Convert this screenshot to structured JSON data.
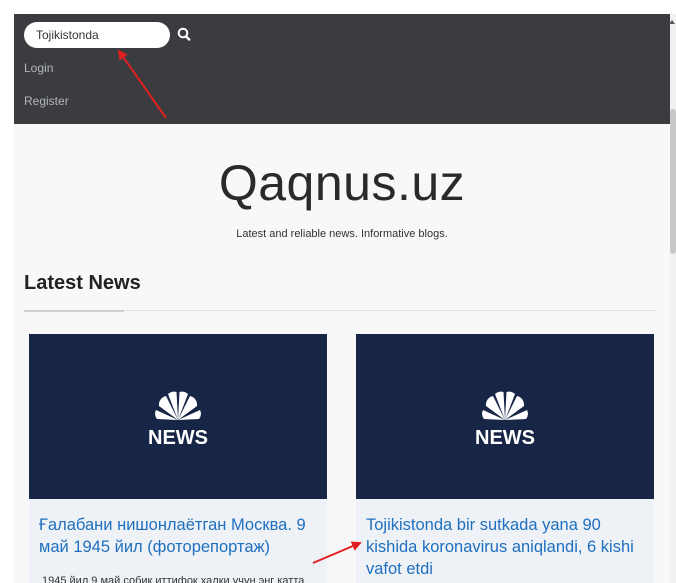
{
  "navbar": {
    "search": {
      "value": "Tojikistonda",
      "icon": "search-icon"
    },
    "login_label": "Login",
    "register_label": "Register"
  },
  "hero": {
    "site_title": "Qaqnus.uz",
    "tagline": "Latest and reliable news. Informative blogs."
  },
  "latest_news": {
    "heading": "Latest News",
    "cards": [
      {
        "image_logo_label": "NEWS",
        "title": "Ғалабани нишонлаётган Москва. 9 май 1945 йил (фоторепортаж)",
        "excerpt": "1945 йил 9 май собиқ иттифоқ халқи учун энг катта"
      },
      {
        "image_logo_label": "NEWS",
        "title": "Tojikistonda bir sutkada yana 90 kishida koronavirus aniqlandi, 6 kishi vafot etdi",
        "excerpt": ""
      }
    ]
  },
  "colors": {
    "navbar_bg": "#3a3c3f",
    "card_image_bg": "#172646",
    "card_title_link": "#1e6fbf",
    "annotation_arrow": "#e02020"
  }
}
